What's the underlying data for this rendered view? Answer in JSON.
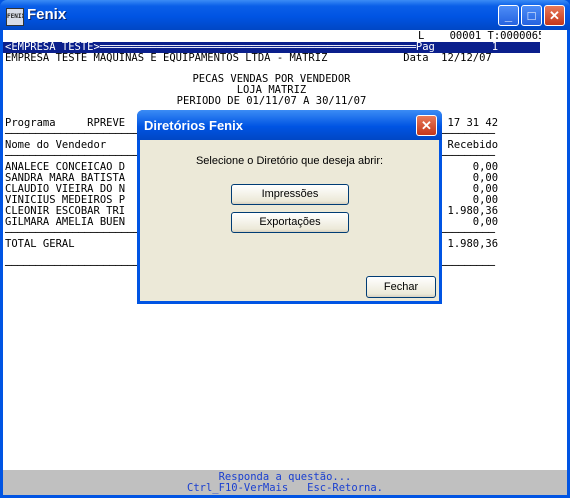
{
  "window": {
    "title": "Fenix",
    "icon_label": "FENIX"
  },
  "report": {
    "line_top": "L    00001 T:0000065",
    "header_bar": "<EMPRESA TESTE>══════════════════════════════════════════════════Pag         1",
    "line_company": "EMPRESA TESTE MAQUINAS E EQUIPAMENTOS LTDA - MATRIZ            Data  12/12/07",
    "title1": "PECAS VENDAS POR VENDEDOR",
    "title2": "LOJA MATRIZ",
    "title3": "PERIODO DE 01/11/07 A 30/11/07",
    "line_programa": "Programa     RPREVE                                             Hora  17 31 42",
    "line_nome": "Nome do Vendedor                                                Total Recebido",
    "rows": [
      "ANALECE CONCEICAO D                                                       0,00",
      "SANDRA MARA BATISTA                                                       0,00",
      "CLAUDIO VIEIRA DO N                                                       0,00",
      "VINICIUS MEDEIROS P                                                       0,00",
      "CLEONIR ESCOBAR TRI                                                   1.980,36",
      "GILMARA AMELIA BUEN                                                       0,00"
    ],
    "line_total": "TOTAL GERAL                                                           1.980,36"
  },
  "status": {
    "line1": "Responda a questão...",
    "line2": "Ctrl_F10-VerMais   Esc-Retorna."
  },
  "dialog": {
    "title": "Diretórios Fenix",
    "prompt": "Selecione o Diretório que deseja abrir:",
    "btn_impressoes": "Impressões",
    "btn_exportacoes": "Exportações",
    "btn_fechar": "Fechar"
  }
}
